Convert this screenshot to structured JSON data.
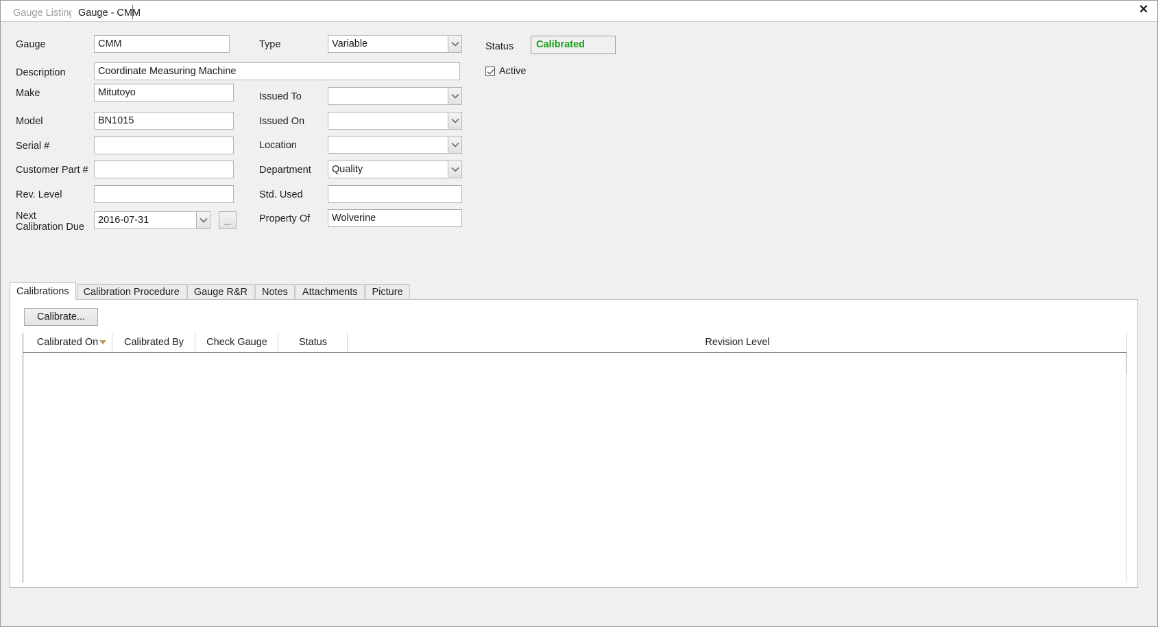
{
  "window": {
    "close_icon": "close-icon",
    "close_label": "✕"
  },
  "document_tabs": [
    {
      "label": "Gauge Listing",
      "active": false
    },
    {
      "label": "Gauge - CMM",
      "active": true
    }
  ],
  "form": {
    "left_column": [
      {
        "label": "Gauge",
        "value": "CMM",
        "type": "text"
      },
      {
        "label": "Description",
        "value": "Coordinate Measuring Machine",
        "type": "text"
      },
      {
        "label": "Make",
        "value": "Mitutoyo",
        "type": "text"
      },
      {
        "label": "Model",
        "value": "BN1015",
        "type": "text"
      },
      {
        "label": "Serial #",
        "value": "",
        "type": "text"
      },
      {
        "label": "Customer Part #",
        "value": "",
        "type": "text"
      },
      {
        "label": "Rev. Level",
        "value": "",
        "type": "text"
      },
      {
        "label": "Next Calibration Due",
        "value": "2016-07-31",
        "type": "combo"
      }
    ],
    "next_cal_due_label_line1": "Next",
    "next_cal_due_label_line2": "Calibration Due",
    "ellipsis_button_label": "...",
    "right_column": [
      {
        "label": "Type",
        "value": "Variable",
        "type": "combo"
      },
      {
        "label": "Issued To",
        "value": "",
        "type": "combo"
      },
      {
        "label": "Issued On",
        "value": "",
        "type": "combo"
      },
      {
        "label": "Location",
        "value": "",
        "type": "combo"
      },
      {
        "label": "Department",
        "value": "Quality",
        "type": "combo"
      },
      {
        "label": "Std. Used",
        "value": "",
        "type": "text"
      },
      {
        "label": "Property Of",
        "value": "Wolverine",
        "type": "text"
      }
    ],
    "status": {
      "label": "Status",
      "value": "Calibrated",
      "color": "#14a014"
    },
    "active_checkbox": {
      "label": "Active",
      "checked": true
    }
  },
  "sub_tabs": [
    {
      "label": "Calibrations",
      "active": true
    },
    {
      "label": "Calibration Procedure",
      "active": false
    },
    {
      "label": "Gauge R&R",
      "active": false
    },
    {
      "label": "Notes",
      "active": false
    },
    {
      "label": "Attachments",
      "active": false
    },
    {
      "label": "Picture",
      "active": false
    }
  ],
  "calibrations_panel": {
    "calibrate_button": "Calibrate...",
    "grid": {
      "columns": [
        {
          "label": "Calibrated On",
          "sorted": true,
          "sort_direction": "descending"
        },
        {
          "label": "Calibrated By",
          "sorted": false
        },
        {
          "label": "Check Gauge",
          "sorted": false
        },
        {
          "label": "Status",
          "sorted": false
        },
        {
          "label": "Revision Level",
          "sorted": false
        }
      ],
      "rows": []
    }
  }
}
